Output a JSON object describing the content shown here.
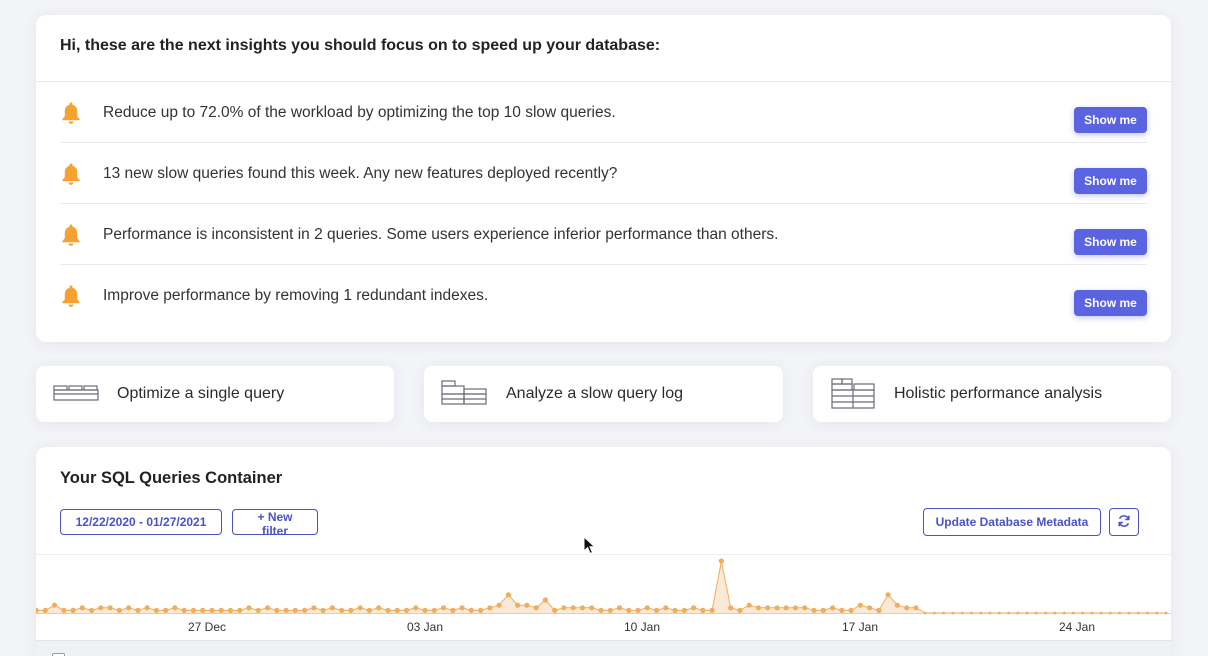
{
  "insights": {
    "title": "Hi, these are the next insights you should focus on to speed up your database:",
    "items": [
      {
        "text": "Reduce up to 72.0% of the workload by optimizing the top 10 slow queries.",
        "button": "Show me"
      },
      {
        "text": "13 new slow queries found this week. Any new features deployed recently?",
        "button": "Show me"
      },
      {
        "text": "Performance is inconsistent in 2 queries. Some users experience inferior performance than others.",
        "button": "Show me"
      },
      {
        "text": "Improve performance by removing 1 redundant indexes.",
        "button": "Show me"
      }
    ],
    "icon": "bell-icon",
    "bell_color": "#f5a230"
  },
  "actions": [
    {
      "label": "Optimize a single query",
      "icon": "single-query-blocks-icon"
    },
    {
      "label": "Analyze a slow query log",
      "icon": "slow-query-log-blocks-icon"
    },
    {
      "label": "Holistic performance analysis",
      "icon": "holistic-analysis-blocks-icon"
    }
  ],
  "queries": {
    "title": "Your SQL Queries Container",
    "date_range": "12/22/2020 - 01/27/2021",
    "new_filter": "+ New filter",
    "update_metadata": "Update Database Metadata",
    "refresh_icon": "refresh-icon"
  },
  "colors": {
    "accent": "#5a63e0",
    "chart_line": "#f0ad5a",
    "chart_fill": "#fbe9d8"
  },
  "chart_data": {
    "type": "area",
    "x_tick_labels": [
      "27 Dec",
      "03 Jan",
      "10 Jan",
      "17 Jan",
      "24 Jan"
    ],
    "values": [
      1,
      1,
      3,
      1,
      1,
      2,
      1,
      2,
      2,
      1,
      2,
      1,
      2,
      1,
      1,
      2,
      1,
      1,
      1,
      1,
      1,
      1,
      1,
      2,
      1,
      2,
      1,
      1,
      1,
      1,
      2,
      1,
      2,
      1,
      1,
      2,
      1,
      2,
      1,
      1,
      1,
      2,
      1,
      1,
      2,
      1,
      2,
      1,
      1,
      2,
      3,
      7,
      3,
      3,
      2,
      5,
      1,
      2,
      2,
      2,
      2,
      1,
      1,
      2,
      1,
      1,
      2,
      1,
      2,
      1,
      1,
      2,
      1,
      1,
      20,
      2,
      1,
      3,
      2,
      2,
      2,
      2,
      2,
      2,
      1,
      1,
      2,
      1,
      1,
      3,
      2,
      1,
      7,
      3,
      2,
      2,
      0,
      0,
      0,
      0,
      0,
      0,
      0,
      0,
      0,
      0,
      0,
      0,
      0,
      0,
      0,
      0,
      0,
      0,
      0,
      0,
      0,
      0,
      0,
      0,
      0,
      0,
      0
    ],
    "grid": false
  }
}
